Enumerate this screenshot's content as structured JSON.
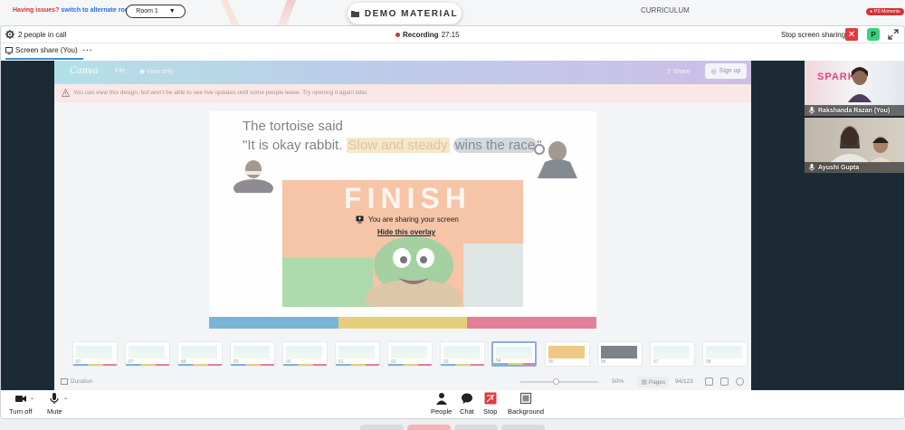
{
  "top": {
    "issues_text": "Having issues?",
    "alternate_link": "switch to alternate room",
    "room_value": "Room 1",
    "demo_label": "DEMO MATERIAL",
    "curriculum_label": "CURRICULUM",
    "ps_badge": "PS Moments"
  },
  "call": {
    "people_count": "2 people in call",
    "recording_label": "Recording",
    "recording_time": "27:15",
    "stop_sharing_label": "Stop screen sharing",
    "participant_badge": "P",
    "share_tab_label": "Screen share (You)"
  },
  "canva": {
    "logo": "Canva",
    "file_label": "File",
    "view_label": "View only",
    "share_label": "Share",
    "signup_label": "Sign up",
    "warning": "You can view this design, but won't be able to see live updates until some people leave. Try opening it again later.",
    "slide_line1": "The tortoise said",
    "slide_line2_a": "\"It is okay rabbit. ",
    "slide_line2_hl1": "Slow and steady",
    "slide_line2_hl2": "wins the race",
    "slide_line2_end": "\"",
    "finish_word": "FINISH",
    "thumbnails": [
      "87",
      "87",
      "88",
      "89",
      "90",
      "91",
      "92",
      "93",
      "94",
      "95",
      "96",
      "97",
      "98"
    ],
    "duration_label": "Duration",
    "zoom_value": "50%",
    "pages_label": "Pages",
    "pages_value": "94/123"
  },
  "overlay": {
    "sharing_msg": "You are sharing your screen",
    "hide_link": "Hide this overlay"
  },
  "participants": [
    {
      "name": "Rakshanda Razan (You)",
      "logo_text": "SPARK"
    },
    {
      "name": "Ayushi Gupta"
    }
  ],
  "toolbar": {
    "turn_off": "Turn off",
    "mute": "Mute",
    "people": "People",
    "chat": "Chat",
    "stop": "Stop",
    "background": "Background"
  }
}
